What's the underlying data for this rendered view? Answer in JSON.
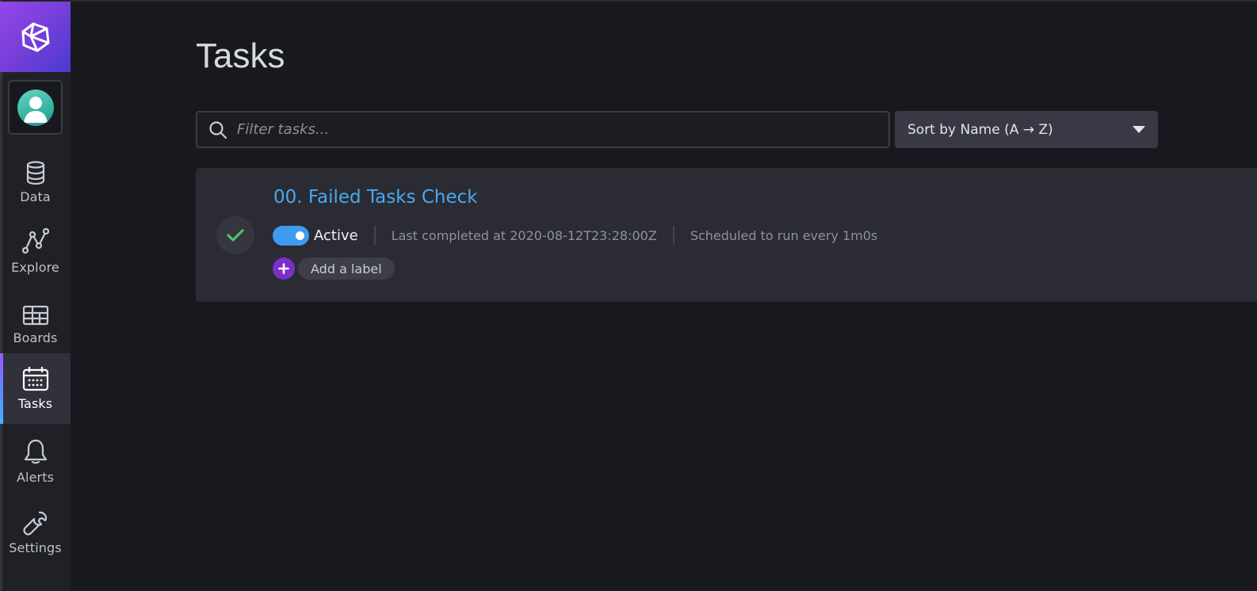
{
  "sidebar": {
    "logo_icon": "influx-cuboid-logo-icon",
    "avatar_icon": "user-avatar-icon",
    "items": [
      {
        "label": "Data",
        "icon": "database-icon"
      },
      {
        "label": "Explore",
        "icon": "graph-line-icon"
      },
      {
        "label": "Boards",
        "icon": "dashboard-grid-icon"
      },
      {
        "label": "Tasks",
        "icon": "calendar-icon",
        "active": true
      },
      {
        "label": "Alerts",
        "icon": "bell-icon"
      },
      {
        "label": "Settings",
        "icon": "wrench-icon"
      }
    ]
  },
  "page": {
    "title": "Tasks"
  },
  "search": {
    "placeholder": "Filter tasks...",
    "value": "",
    "icon": "search-icon"
  },
  "sort": {
    "label": "Sort by Name (A → Z)"
  },
  "tasks": [
    {
      "name": "00. Failed Tasks Check",
      "status": "Active",
      "last_completed": "Last completed at 2020-08-12T23:28:00Z",
      "schedule": "Scheduled to run every 1m0s",
      "add_label_text": "Add a label",
      "status_icon": "checkmark-icon"
    }
  ],
  "colors": {
    "background": "#18191e",
    "sidebar": "#202127",
    "card": "#2a2b33",
    "link": "#4aa8ef",
    "toggle_on": "#3e9bf0",
    "success": "#4cc36a",
    "label_plus": "#7b2fc9",
    "logo_gradient_start": "#9446e6",
    "logo_gradient_end": "#4a3ad0"
  }
}
